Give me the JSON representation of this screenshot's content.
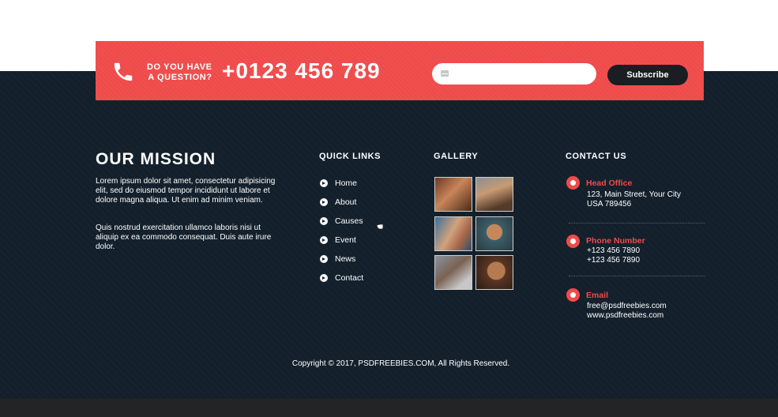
{
  "cta": {
    "question_line1": "DO YOU HAVE",
    "question_line2": "A QUESTION?",
    "phone": "+0123 456 789",
    "email_placeholder": "",
    "subscribe_label": "Subscribe",
    "icons": {
      "phone": "phone-icon",
      "email": "envelope-icon"
    },
    "color": "#ef4b4b"
  },
  "mission": {
    "title": "OUR MISSION",
    "paragraph1": "Lorem ipsum dolor sit amet, consectetur adipisicing elit, sed do eiusmod tempor incididunt ut labore et dolore magna aliqua. Ut enim ad minim veniam.",
    "paragraph2": "Quis nostrud exercitation ullamco laboris nisi ut aliquip ex ea commodo consequat. Duis aute irure dolor."
  },
  "quick_links": {
    "title": "QUICK LINKS",
    "items": [
      {
        "label": "Home"
      },
      {
        "label": "About"
      },
      {
        "label": "Causes"
      },
      {
        "label": "Event"
      },
      {
        "label": "News"
      },
      {
        "label": "Contact"
      }
    ]
  },
  "gallery": {
    "title": "GALLERY",
    "images": [
      "photo-1",
      "photo-2",
      "photo-3",
      "photo-4",
      "photo-5",
      "photo-6"
    ]
  },
  "contact": {
    "title": "CONTACT US",
    "head_office": {
      "label": "Head Office",
      "line1": "123, Main Street, Your City",
      "line2": "USA 789456",
      "icon": "location-pin-icon"
    },
    "phone": {
      "label": "Phone Number",
      "line1": "+123 456 7890",
      "line2": "+123 456 7890",
      "icon": "phone-icon"
    },
    "email": {
      "label": "Email",
      "line1": "free@psdfreebies.com",
      "line2": "www.psdfreebies.com",
      "icon": "envelope-icon"
    }
  },
  "copyright": "Copyright © 2017, PSDFREEBIES.COM, All Rights Reserved.",
  "colors": {
    "accent": "#ef4b4b",
    "footer_bg": "#13202c",
    "button_dark": "#1a1d22"
  }
}
